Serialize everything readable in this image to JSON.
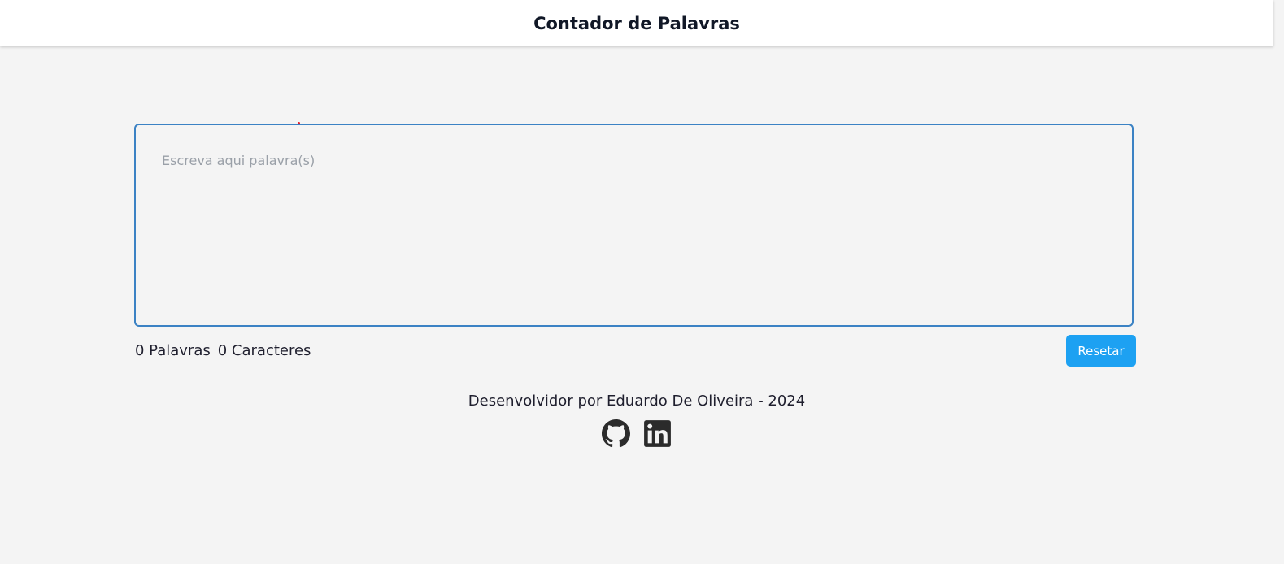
{
  "header": {
    "title": "Contador de Palavras"
  },
  "editor": {
    "placeholder": "Escreva aqui palavra(s)",
    "value": ""
  },
  "stats": {
    "words": "0 Palavras",
    "characters": "0 Caracteres"
  },
  "actions": {
    "reset_label": "Resetar"
  },
  "footer": {
    "credit": "Desenvolvidor por Eduardo De Oliveira - 2024",
    "links": [
      {
        "icon": "github-icon"
      },
      {
        "icon": "linkedin-icon"
      }
    ]
  },
  "colors": {
    "accent": "#1da1f2",
    "editor_border": "#3b82c4",
    "background": "#f4f4f4",
    "header_bg": "#ffffff"
  }
}
